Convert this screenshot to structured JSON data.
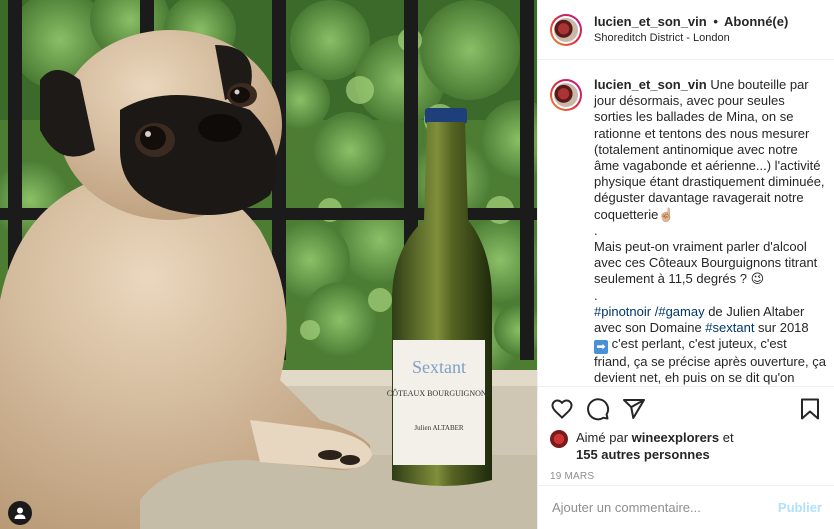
{
  "post": {
    "username": "lucien_et_son_vin",
    "separator": "•",
    "follow_status": "Abonné(e)",
    "location": "Shoreditch District - London",
    "caption_lines": [
      "Une bouteille par jour désormais, avec pour seules sorties les ballades de Mina, on se rationne et tentons des nous mesurer (totalement antinomique avec notre âme vagabonde et aérienne...) l'activité physique étant drastiquement diminuée, déguster davantage ravagerait notre coquetterie☝🏼",
      ".",
      "Mais peut-on vraiment parler d'alcool avec ces Côteaux Bourguignons titrant seulement à 11,5 degrés ? 😉",
      "."
    ],
    "hashtag_pinot": "#pinotnoir",
    "hashtag_sep": " /",
    "hashtag_gamay": "#gamay",
    "text_producer": " de Julien Altaber avec son Domaine ",
    "hashtag_sextant": "#sextant",
    "text_year": " sur 2018",
    "arrow_emoji": "➡",
    "text_tasting": " c'est perlant, c'est juteux, c'est friand, ça se précise après ouverture, ça devient net, eh puis on se dit qu'on",
    "likes_prefix": "Aimé par",
    "likes_user": "wineexplorers",
    "likes_and": "et",
    "likes_others": "155 autres personnes",
    "date": "19 MARS"
  },
  "image": {
    "label_brand": "Sextant",
    "label_appellation": "CÔTEAUX BOURGUIGNONS",
    "label_producer": "Julien ALTABER"
  },
  "comment_box": {
    "placeholder": "Ajouter un commentaire...",
    "publish_label": "Publier"
  },
  "colors": {
    "hashtag": "#00376b",
    "publish_disabled": "#b2dffc",
    "secondary_text": "#8e8e8e",
    "avatar_ring": "#dc2743"
  },
  "icons": [
    "heart-icon",
    "comment-icon",
    "share-icon",
    "bookmark-icon",
    "user-tag-icon"
  ]
}
